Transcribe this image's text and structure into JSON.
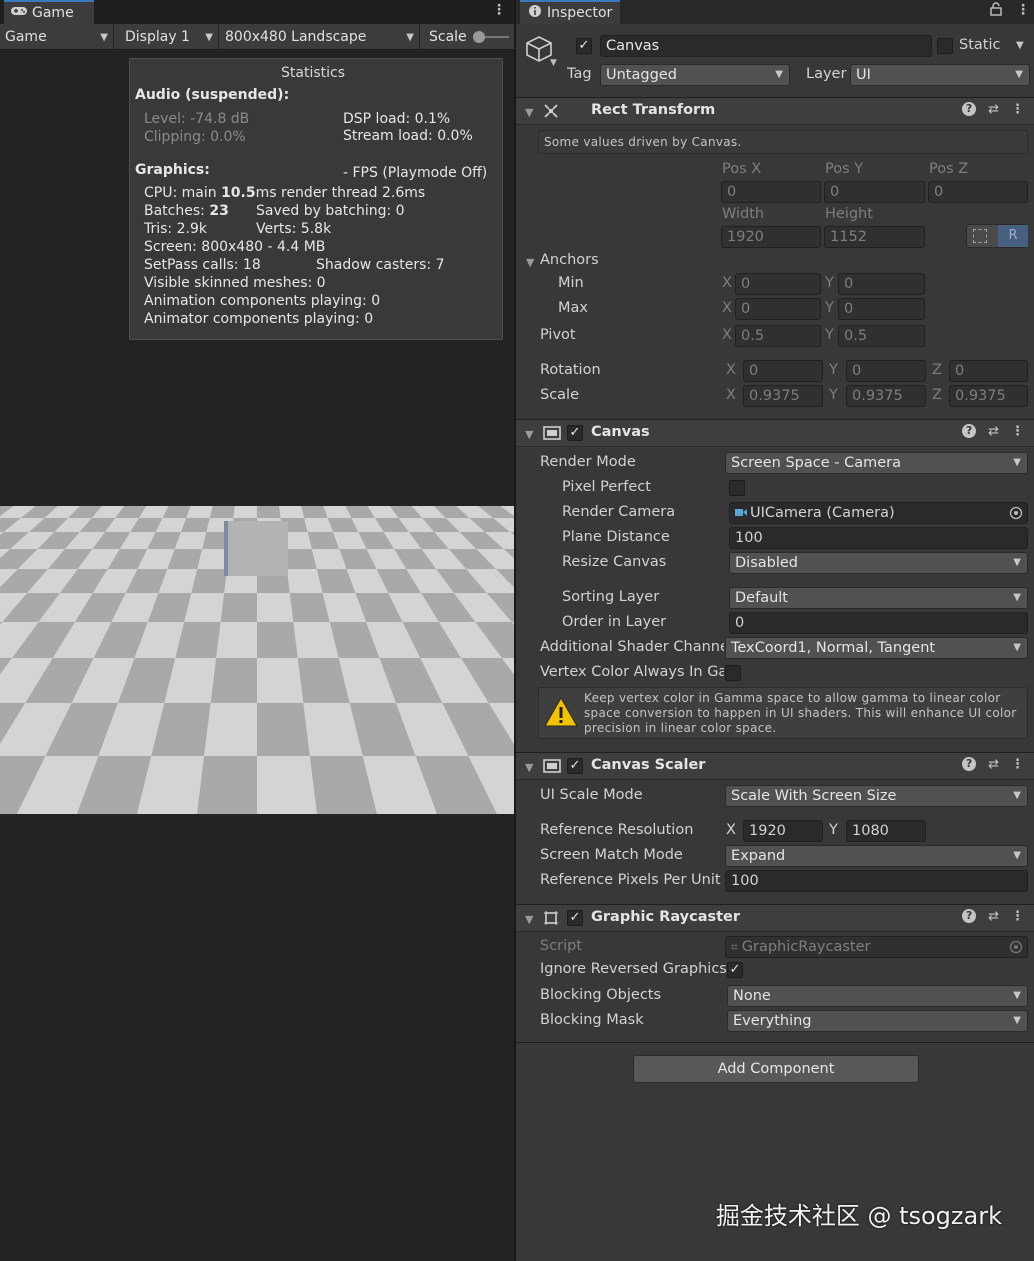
{
  "game": {
    "tab_label": "Game",
    "toolbar": {
      "mode": "Game",
      "display": "Display 1",
      "resolution": "800x480 Landscape",
      "scale_label": "Scale"
    },
    "statistics": {
      "title": "Statistics",
      "audio_header": "Audio (suspended):",
      "level": "Level: -74.8 dB",
      "clipping": "Clipping: 0.0%",
      "dsp_load": "DSP load: 0.1%",
      "stream_load": "Stream load: 0.0%",
      "graphics_header": "Graphics:",
      "fps": "- FPS (Playmode Off)",
      "cpu_prefix": "CPU: main ",
      "cpu_main": "10.5",
      "cpu_suffix": "ms  render thread 2.6ms",
      "batches_prefix": "Batches: ",
      "batches": "23",
      "saved_by_batching": "Saved by batching: 0",
      "tris": "Tris: 2.9k",
      "verts": "Verts: 5.8k",
      "screen": "Screen: 800x480 - 4.4 MB",
      "setpass": "SetPass calls: 18",
      "shadow_casters": "Shadow casters: 7",
      "skinned_meshes": "Visible skinned meshes: 0",
      "animation_components": "Animation components playing: 0",
      "animator_components": "Animator components playing: 0"
    }
  },
  "inspector": {
    "tab_label": "Inspector",
    "object": {
      "name": "Canvas",
      "active": true,
      "static_label": "Static",
      "tag_label": "Tag",
      "tag_value": "Untagged",
      "layer_label": "Layer",
      "layer_value": "UI"
    },
    "rect_transform": {
      "title": "Rect Transform",
      "driven_note": "Some values driven by Canvas.",
      "pos_x_label": "Pos X",
      "pos_y_label": "Pos Y",
      "pos_z_label": "Pos Z",
      "pos_x": "0",
      "pos_y": "0",
      "pos_z": "0",
      "width_label": "Width",
      "height_label": "Height",
      "width": "1920",
      "height": "1152",
      "raw_button": "R",
      "anchors_label": "Anchors",
      "min_label": "Min",
      "max_label": "Max",
      "min_x": "0",
      "min_y": "0",
      "max_x": "0",
      "max_y": "0",
      "pivot_label": "Pivot",
      "pivot_x": "0.5",
      "pivot_y": "0.5",
      "rotation_label": "Rotation",
      "rot_x": "0",
      "rot_y": "0",
      "rot_z": "0",
      "scale_label": "Scale",
      "scale_x": "0.9375",
      "scale_y": "0.9375",
      "scale_z": "0.9375",
      "x": "X",
      "y": "Y",
      "z": "Z"
    },
    "canvas": {
      "title": "Canvas",
      "render_mode_label": "Render Mode",
      "render_mode": "Screen Space - Camera",
      "pixel_perfect_label": "Pixel Perfect",
      "render_camera_label": "Render Camera",
      "render_camera": "UICamera (Camera)",
      "plane_distance_label": "Plane Distance",
      "plane_distance": "100",
      "resize_canvas_label": "Resize Canvas",
      "resize_canvas": "Disabled",
      "sorting_layer_label": "Sorting Layer",
      "sorting_layer": "Default",
      "order_in_layer_label": "Order in Layer",
      "order_in_layer": "0",
      "shader_channels_label": "Additional Shader Channels",
      "shader_channels": "TexCoord1, Normal, Tangent",
      "vertex_color_label": "Vertex Color Always In Gamma",
      "warning": "Keep vertex color in Gamma space to allow gamma to linear color space conversion to happen in UI shaders. This will enhance UI color precision in linear color space."
    },
    "canvas_scaler": {
      "title": "Canvas Scaler",
      "ui_scale_mode_label": "UI Scale Mode",
      "ui_scale_mode": "Scale With Screen Size",
      "ref_resolution_label": "Reference Resolution",
      "ref_x": "1920",
      "ref_y": "1080",
      "match_mode_label": "Screen Match Mode",
      "match_mode": "Expand",
      "ppu_label": "Reference Pixels Per Unit",
      "ppu": "100"
    },
    "graphic_raycaster": {
      "title": "Graphic Raycaster",
      "script_label": "Script",
      "script": "GraphicRaycaster",
      "ignore_reversed_label": "Ignore Reversed Graphics",
      "blocking_objects_label": "Blocking Objects",
      "blocking_objects": "None",
      "blocking_mask_label": "Blocking Mask",
      "blocking_mask": "Everything"
    },
    "add_component": "Add Component"
  },
  "watermark": "掘金技术社区 @ tsogzark",
  "colors": {
    "accent": "#3a79bb",
    "panel": "#383838",
    "field": "#2a2a2a",
    "warning": "#f2c200"
  }
}
